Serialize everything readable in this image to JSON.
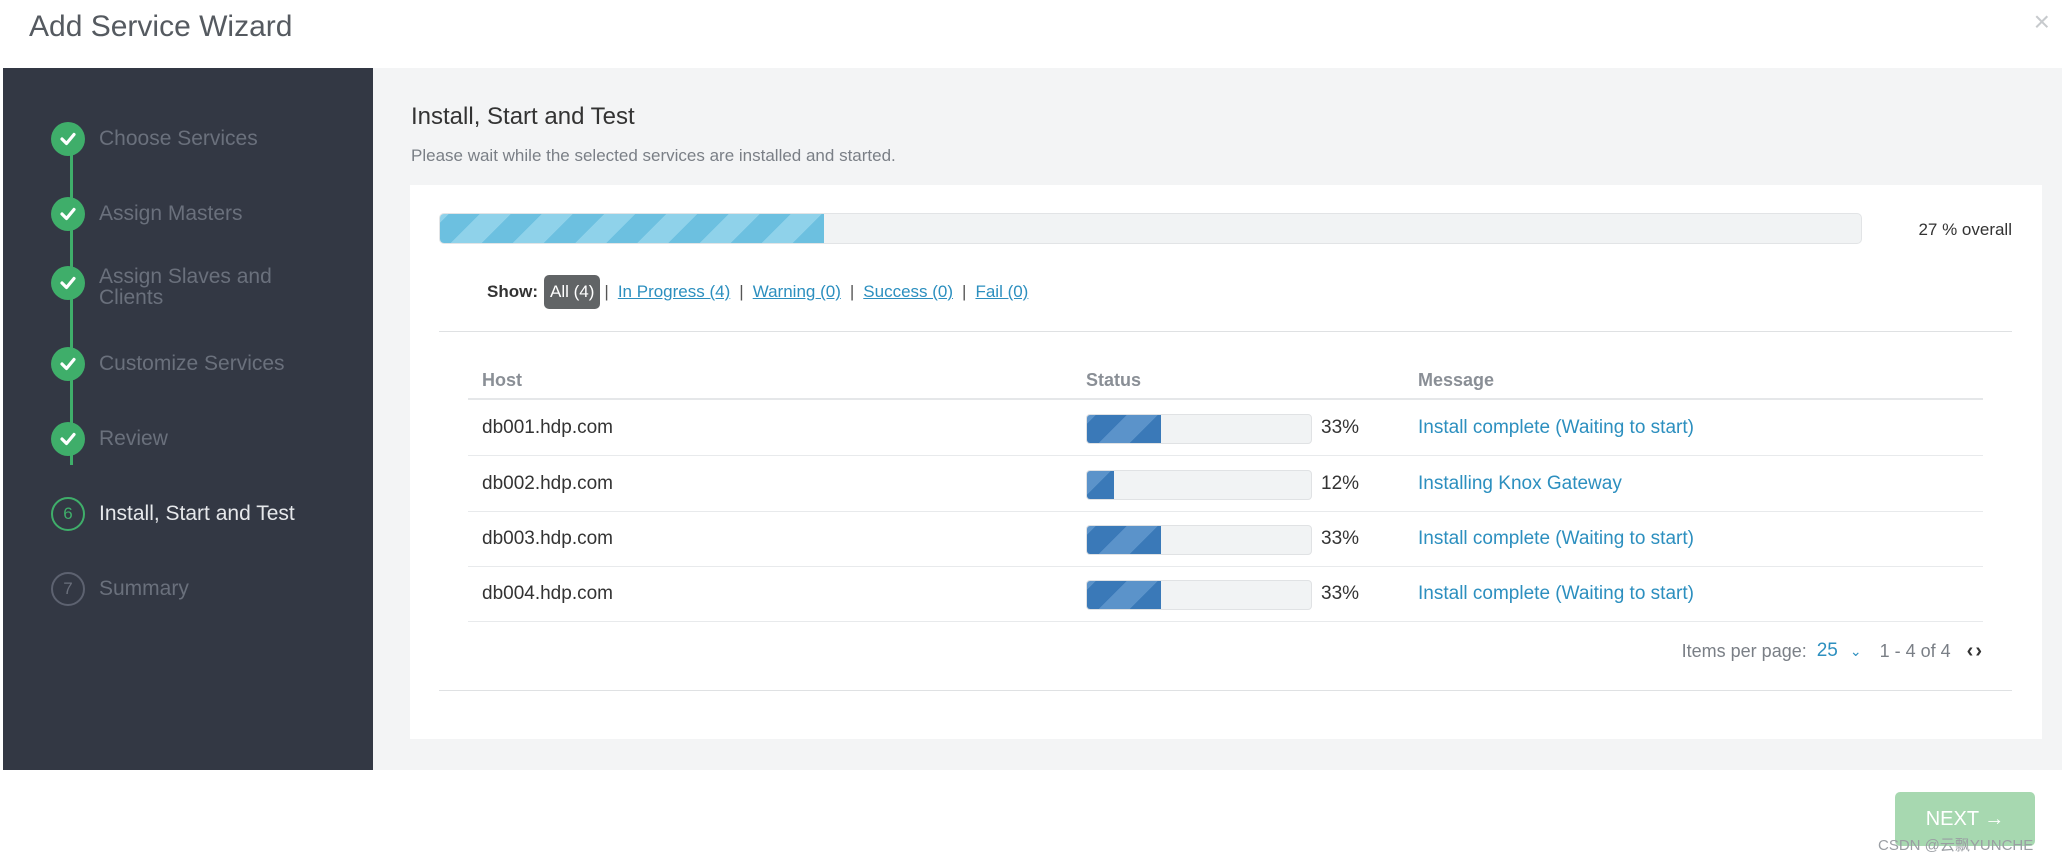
{
  "modal": {
    "title": "Add Service Wizard",
    "close_icon": "×"
  },
  "sidebar": {
    "steps": [
      {
        "label": "Choose Services",
        "state": "done"
      },
      {
        "label": "Assign Masters",
        "state": "done"
      },
      {
        "label": "Assign Slaves and Clients",
        "state": "done"
      },
      {
        "label": "Customize Services",
        "state": "done"
      },
      {
        "label": "Review",
        "state": "done"
      },
      {
        "label": "Install, Start and Test",
        "state": "current",
        "number": "6"
      },
      {
        "label": "Summary",
        "state": "future",
        "number": "7"
      }
    ]
  },
  "main": {
    "title": "Install, Start and Test",
    "subtitle": "Please wait while the selected services are installed and started.",
    "overall": {
      "progress": 27,
      "text": "27 % overall"
    },
    "filters": {
      "show_label": "Show:",
      "all": "All (4)",
      "in_progress": "In Progress (4)",
      "warning": "Warning (0)",
      "success": "Success (0)",
      "fail": "Fail (0)",
      "separator": "|"
    },
    "table": {
      "headers": {
        "host": "Host",
        "status": "Status",
        "message": "Message"
      },
      "rows": [
        {
          "host": "db001.hdp.com",
          "progress": 33,
          "percent": "33%",
          "message": "Install complete (Waiting to start)"
        },
        {
          "host": "db002.hdp.com",
          "progress": 12,
          "percent": "12%",
          "message": "Installing Knox Gateway"
        },
        {
          "host": "db003.hdp.com",
          "progress": 33,
          "percent": "33%",
          "message": "Install complete (Waiting to start)"
        },
        {
          "host": "db004.hdp.com",
          "progress": 33,
          "percent": "33%",
          "message": "Install complete (Waiting to start)"
        }
      ]
    },
    "pager": {
      "label": "Items per page:",
      "per_page": "25",
      "range": "1 - 4 of 4"
    }
  },
  "footer": {
    "next_label": "NEXT →",
    "watermark": "CSDN @云飘YUNCHE"
  },
  "colors": {
    "success": "#3fae6a",
    "link": "#2c8fbf",
    "sidebar_bg": "#333844",
    "next_button": "#a7d8b0"
  }
}
